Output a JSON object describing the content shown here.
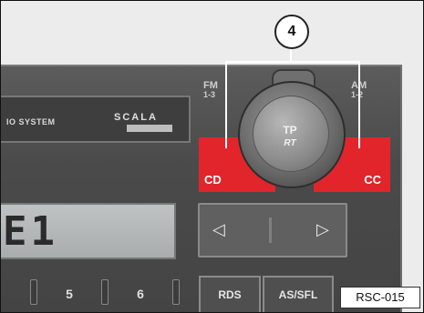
{
  "radio": {
    "brand_text": "IO SYSTEM",
    "model_logo": "SCALA",
    "display_text": "E1",
    "buttons": {
      "cd": "CD",
      "cc": "CC",
      "fm_top": "FM",
      "fm_bottom": "1-3",
      "am_top": "AM",
      "am_bottom": "1-2",
      "knob_top": "TP",
      "knob_bottom": "RT"
    },
    "seek": {
      "left": "◁",
      "right": "▷"
    },
    "presets": [
      "5",
      "6"
    ],
    "function_buttons": [
      "RDS",
      "AS/SFL"
    ]
  },
  "callout": {
    "number": "4"
  },
  "figure_code": "RSC-015"
}
